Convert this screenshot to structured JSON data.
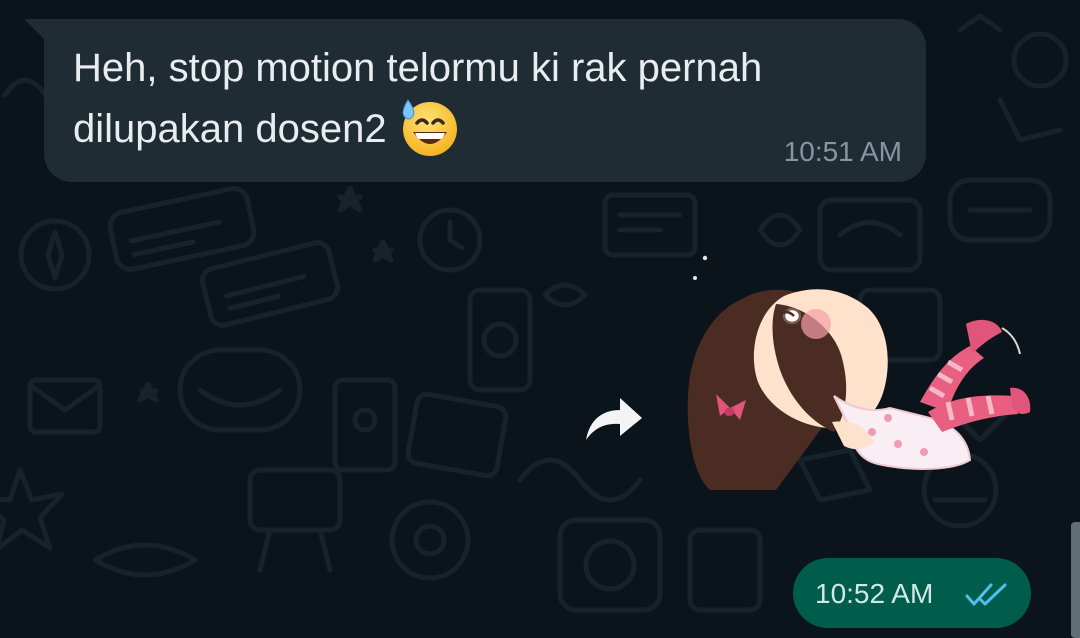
{
  "conversation": {
    "incoming_message": {
      "text": "Heh, stop motion telormu ki rak pernah\ndilupakan dosen2",
      "emoji": "grinning-face-with-sweat-emoji",
      "time": "10:51 AM"
    },
    "sticker": {
      "icon": "girl-falling-sticker"
    },
    "forward": {
      "icon": "forward-arrow-icon"
    },
    "outgoing_message": {
      "time": "10:52 AM",
      "status_icon": "double-check-read-icon"
    }
  },
  "colors": {
    "background": "#0b141a",
    "incoming_bubble": "#1f2c34",
    "outgoing_bubble": "#005c4b",
    "text": "#e9edef",
    "timestamp": "#8696a0",
    "read_ticks": "#53bdeb"
  }
}
